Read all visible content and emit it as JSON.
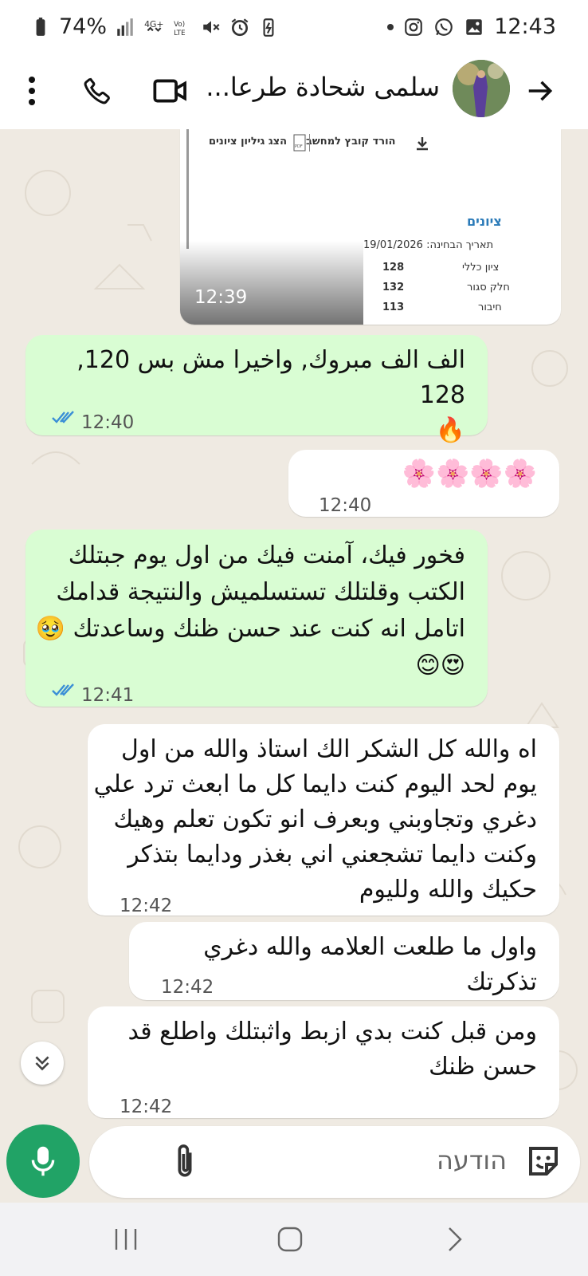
{
  "status_bar": {
    "battery": "74%",
    "time": "12:43"
  },
  "header": {
    "contact_name": "سلمى شحادة طرعا...",
    "back_icon": "arrow-right-icon",
    "video_icon": "video-call-icon",
    "call_icon": "phone-icon",
    "menu_icon": "more-vertical-icon"
  },
  "image_message": {
    "time": "12:39",
    "doc": {
      "download_label": "הורד קובץ למחשב",
      "view_label": "הצג גיליון ציונים",
      "section_title": "ציונים",
      "exam_date_label": "תאריך הבחינה: 19/01/2026",
      "rows": [
        {
          "label": "ציון כללי",
          "value": "128"
        },
        {
          "label": "חלק סגור",
          "value": "132"
        },
        {
          "label": "חיבור",
          "value": "113"
        }
      ]
    }
  },
  "messages": [
    {
      "dir": "out",
      "text": "الف الف مبروك, واخيرا مش بس 120, 128\n🔥",
      "time": "12:40",
      "read": true
    },
    {
      "dir": "in",
      "text": "🌸🌸🌸🌸",
      "time": "12:40"
    },
    {
      "dir": "out",
      "text": "فخور فيك، آمنت فيك من اول يوم جبتلك\nالكتب وقلتلك تستسلميش والنتيجة قدامك\nاتامل انه كنت عند حسن ظنك وساعدتك 🥹\n😍😊",
      "time": "12:41",
      "read": true
    },
    {
      "dir": "in",
      "text": "اه والله كل الشكر الك استاذ والله من اول\nيوم لحد اليوم كنت دايما كل ما ابعث ترد علي\nدغري وتجاوبني وبعرف انو تكون تعلم وهيك\nوكنت دايما تشجعني اني بغذر ودايما بتذكر\nحكيك والله ولليوم",
      "time": "12:42"
    },
    {
      "dir": "in",
      "text": "واول ما طلعت العلامه والله دغري تذكرتك",
      "time": "12:42"
    },
    {
      "dir": "in",
      "text": "ومن قبل كنت بدي ازبط واثبتلك واطلع قد\nحسن ظنك",
      "time": "12:42"
    }
  ],
  "input": {
    "placeholder": "הודעה"
  },
  "colors": {
    "outgoing_bubble": "#d9fdd3",
    "incoming_bubble": "#ffffff",
    "mic_button": "#21a366",
    "read_ticks": "#53bdeb"
  }
}
